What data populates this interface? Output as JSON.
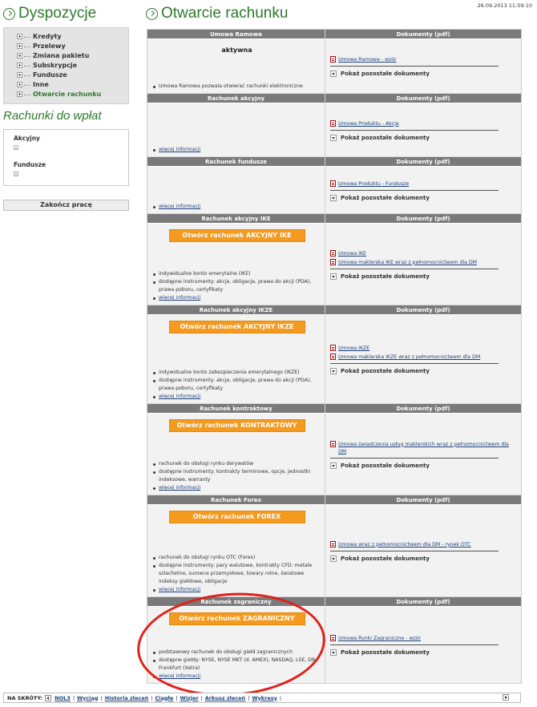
{
  "sidebar": {
    "title": "Dyspozycje",
    "menu": [
      {
        "label": "Kredyty",
        "active": false
      },
      {
        "label": "Przelewy",
        "active": false
      },
      {
        "label": "Zmiana pakietu",
        "active": false
      },
      {
        "label": "Subskrypcje",
        "active": false
      },
      {
        "label": "Fundusze",
        "active": false
      },
      {
        "label": "Inne",
        "active": false
      },
      {
        "label": "Otwarcie rachunku",
        "active": true
      }
    ],
    "deposit_title": "Rachunki do wpłat",
    "deposit_accounts": [
      "Akcyjny",
      "Fundusze"
    ],
    "end_button": "Zakończ pracę"
  },
  "header": {
    "title": "Otwarcie rachunku",
    "datetime": "26.09.2013 11:59:10"
  },
  "docs_header": "Dokumenty (pdf)",
  "more_docs_label": "Pokaż pozostałe dokumenty",
  "more_info_label": "więcej informacji",
  "sections": [
    {
      "header": "Umowa Ramowa",
      "status": "aktywna",
      "button": "",
      "bullets": [
        "Umowa Ramowa pozwala otwierać rachunki elektroniczne"
      ],
      "has_more_info": false,
      "docs": [
        "Umowa Ramowa - wzór"
      ]
    },
    {
      "header": "Rachunek akcyjny",
      "status": "",
      "button": "",
      "bullets": [],
      "has_more_info": true,
      "docs": [
        "Umowa Produktu - Akcje"
      ]
    },
    {
      "header": "Rachunek fundusze",
      "status": "",
      "button": "",
      "bullets": [],
      "has_more_info": true,
      "docs": [
        "Umowa Produktu - Fundusze"
      ]
    },
    {
      "header": "Rachunek akcyjny IKE",
      "status": "",
      "button": "Otwórz rachunek AKCYJNY IKE",
      "bullets": [
        "indywidualne konto emerytalne (IKE)",
        "dostępne instrumenty: akcje, obligacje, prawa do akcji (PDA), prawa poboru, certyfikaty"
      ],
      "has_more_info": true,
      "docs": [
        "Umowa IKE",
        "Umowa maklerska IKE wraz z pełnomocnictwem dla DM"
      ]
    },
    {
      "header": "Rachunek akcyjny IKZE",
      "status": "",
      "button": "Otwórz rachunek AKCYJNY IKZE",
      "bullets": [
        "indywidualne konto zabezpieczenia emerytalnego (IKZE)",
        "dostępne instrumenty: akcje, obligacje, prawa do akcji (PDA), prawa poboru, certyfikaty"
      ],
      "has_more_info": true,
      "docs": [
        "Umowa IKZE",
        "Umowa maklerska IKZE wraz z pełnomocnictwem dla DM"
      ]
    },
    {
      "header": "Rachunek kontraktowy",
      "status": "",
      "button": "Otwórz rachunek KONTRAKTOWY",
      "bullets": [
        "rachunek do obsługi rynku derywatów",
        "dostępne instrumenty: kontrakty terminowe, opcje, jednostki indeksowe, warranty"
      ],
      "has_more_info": true,
      "docs": [
        "Umowa świadczenia usług maklerskich wraz z pełnomocnictwem dla DM"
      ]
    },
    {
      "header": "Rachunek Forex",
      "status": "",
      "button": "Otwórz rachunek FOREX",
      "bullets": [
        "rachunek do obsługi rynku OTC (Forex)",
        "dostępne instrumenty: pary walutowe, kontrakty CFD: metale szlachetne, surowce przemysłowe, towary rolne, światowe indeksy giełdowe, obligacje"
      ],
      "has_more_info": true,
      "docs": [
        "Umowa wraz z pełnomocnictwem dla DM - rynek OTC"
      ]
    },
    {
      "header": "Rachunek zagraniczny",
      "status": "",
      "button": "Otwórz rachunek ZAGRANICZNY",
      "bullets": [
        "podstawowy rachunek do obsługi giełd zagranicznych",
        "dostępne giełdy: NYSE, NYSE MKT (d. AMEX), NASDAQ, LSE, DB - Frankfurt (Xetra)"
      ],
      "has_more_info": true,
      "docs": [
        "Umowa Rynki Zagraniczne - wzór"
      ]
    }
  ],
  "shortcuts": {
    "label": "NA SKRÓTY:",
    "links": [
      "NOL3",
      "Wyciąg",
      "Historia zleceń",
      "Ciągłe",
      "Wizjer",
      "Arkusz zleceń",
      "Wykresy"
    ]
  },
  "colors": {
    "brand_green": "#2d7a2d",
    "header_gray": "#7a7a7a",
    "open_button_orange": "#f39a1f",
    "annotation_red": "#e0201a",
    "link_blue": "#1a3f7a"
  }
}
